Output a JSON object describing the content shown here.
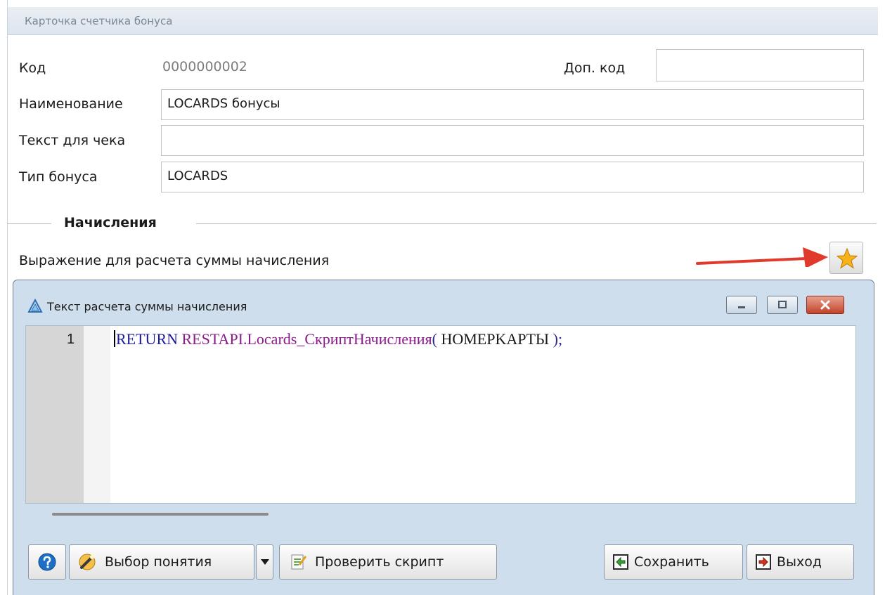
{
  "window": {
    "title": "Карточка счетчика бонуса"
  },
  "fields": {
    "code_label": "Код",
    "code_value": "0000000002",
    "extra_code_label": "Доп. код",
    "extra_code_value": "",
    "name_label": "Наименование",
    "name_value": "LOCARDS бонусы",
    "receipt_text_label": "Текст для чека",
    "receipt_text_value": "",
    "bonus_type_label": "Тип бонуса",
    "bonus_type_value": "LOCARDS"
  },
  "accruals": {
    "section_title": "Начисления",
    "expression_label": "Выражение для расчета суммы начисления",
    "expression_button_icon": "star-icon",
    "annotation_color": "#e03a2c"
  },
  "dialog": {
    "title": "Текст расчета суммы начисления",
    "line_number": "1",
    "code": {
      "keyword": "RETURN",
      "function": "RESTAPI.Locards_СкриптНачисления",
      "open_paren": "(",
      "argument": "HOMEPKAPTЫ",
      "close": ");"
    },
    "buttons": {
      "help_icon": "help-icon",
      "select_concept": "Выбор понятия",
      "check_script": "Проверить скрипт",
      "save": "Сохранить",
      "exit": "Выход"
    }
  }
}
